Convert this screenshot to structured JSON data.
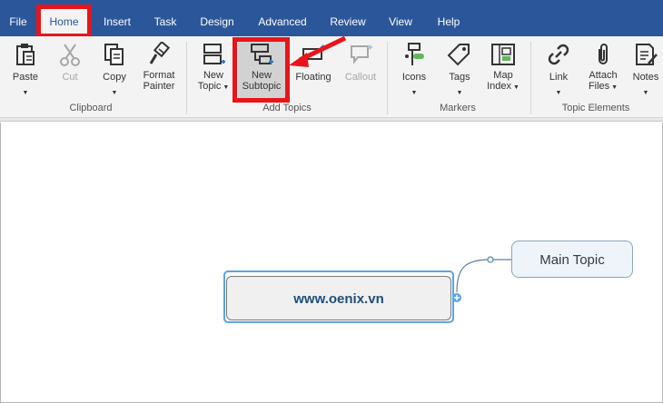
{
  "menu": {
    "tabs": [
      "File",
      "Home",
      "Insert",
      "Task",
      "Design",
      "Advanced",
      "Review",
      "View",
      "Help"
    ],
    "active": "Home"
  },
  "ribbon": {
    "clipboard": {
      "label": "Clipboard",
      "paste": "Paste",
      "cut": "Cut",
      "copy": "Copy",
      "format_painter_1": "Format",
      "format_painter_2": "Painter"
    },
    "add_topics": {
      "label": "Add Topics",
      "new_topic_1": "New",
      "new_topic_2": "Topic",
      "new_subtopic_1": "New",
      "new_subtopic_2": "Subtopic",
      "floating": "Floating",
      "callout": "Callout"
    },
    "markers": {
      "label": "Markers",
      "icons": "Icons",
      "tags": "Tags",
      "map_index_1": "Map",
      "map_index_2": "Index"
    },
    "topic_elements": {
      "label": "Topic Elements",
      "link": "Link",
      "attach_files_1": "Attach",
      "attach_files_2": "Files",
      "notes": "Notes"
    }
  },
  "canvas": {
    "central_topic": "www.oenix.vn",
    "main_topic": "Main Topic"
  },
  "colors": {
    "menubar": "#2b579a",
    "highlight": "#e8141a",
    "selection": "#5aa4e8"
  }
}
